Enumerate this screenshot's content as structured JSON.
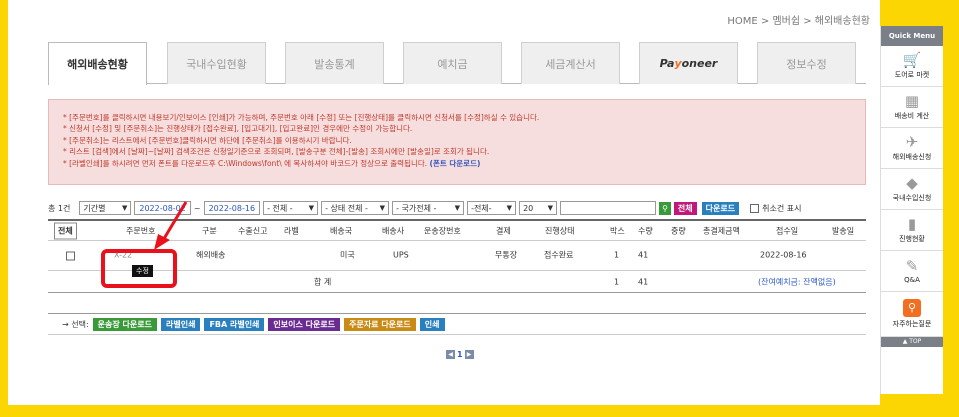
{
  "breadcrumb": "HOME > 멤버쉽 > 해외배송현황",
  "tabs": [
    {
      "label": "해외배송현황",
      "active": true
    },
    {
      "label": "국내수입현황"
    },
    {
      "label": "발송통계"
    },
    {
      "label": "예치금"
    },
    {
      "label": "세금계산서"
    },
    {
      "label": "Payoneer"
    },
    {
      "label": "정보수정"
    }
  ],
  "notice": {
    "lines": [
      "* [주문번호]를 클릭하시면 내용보기/인보이스 [인쇄]가 가능하며, 주문번호 아래 [수정] 또는 [진행상태]를 클릭하시면 신청서를 [수정]하실 수 있습니다.",
      "* 신청서 [수정] 및 [주문취소]는 진행상태가 [접수완료], [입고대기], [입고완료]인 경우에만 수정이 가능합니다.",
      "* [주문취소]는 리스트에서 [주문번호]클릭하시면 하단에 [주문취소]를 이용하시기 바랍니다.",
      "* 리스트 [검색]에서 [날짜]~[날짜] 검색조건은 신청일기준으로 조회되며, [발송구분 전체]-[발송] 조회시에만 [발송일]로 조회가 됩니다.",
      "* [라벨인쇄]를 하시려면 먼저 폰트를 다운로드후 C:\\Windows\\font\\ 에 복사하셔야 바코드가 정상으로 출력됩니다."
    ],
    "font_link": "(폰트 다운로드)"
  },
  "filter": {
    "count": "총 1건",
    "period": "기간별",
    "date_from": "2022-08-02",
    "date_sep": "~",
    "date_to": "2022-08-16",
    "sel_all": "- 전체 -",
    "sel_status": "- 상태 전체 -",
    "sel_country": "- 국가전체 -",
    "sel_all2": "-전체-",
    "page_size": "20",
    "search_btn": "전체",
    "download_btn": "다운로드",
    "cancel_check": "취소건 표시"
  },
  "table": {
    "all_btn": "전체",
    "headers": [
      "주문번호",
      "구분",
      "수출신고",
      "라벨",
      "배송국",
      "배송사",
      "운송장번호",
      "결제",
      "진행상태",
      "박스",
      "수량",
      "중량",
      "총결제금액",
      "접수일",
      "발송일"
    ],
    "row": {
      "order_no": "X-22",
      "edit": "수정",
      "type": "해외배송",
      "country": "미국",
      "carrier": "UPS",
      "payment": "무통장",
      "status": "접수완료",
      "box": "1",
      "qty": "41",
      "date": "2022-08-16"
    },
    "sum": {
      "label": "합 계",
      "box": "1",
      "qty": "41",
      "balance": "(잔여예치금: 잔액없음)"
    }
  },
  "actions": {
    "prefix": "→ 선택:",
    "buttons": [
      {
        "label": "운송장 다운로드",
        "color": "#3a9a3a"
      },
      {
        "label": "라벨인쇄",
        "color": "#2a7fbf"
      },
      {
        "label": "FBA 라벨인쇄",
        "color": "#2a7fbf"
      },
      {
        "label": "인보이스 다운로드",
        "color": "#6a2c91"
      },
      {
        "label": "주문자료 다운로드",
        "color": "#c98a16"
      },
      {
        "label": "인쇄",
        "color": "#2a7fbf"
      }
    ]
  },
  "pager": {
    "prev": "◀",
    "current": "1",
    "next": "▶"
  },
  "sidebar": {
    "header": "Quick Menu",
    "items": [
      {
        "label": "도어로 마켓",
        "icon": "cart-icon"
      },
      {
        "label": "배송비 계산",
        "icon": "calculator-icon"
      },
      {
        "label": "해외배송신청",
        "icon": "airplane-icon"
      },
      {
        "label": "국내수입신청",
        "icon": "box-icon"
      },
      {
        "label": "진행현황",
        "icon": "chart-icon"
      },
      {
        "label": "Q&A",
        "icon": "pencil-icon"
      },
      {
        "label": "자주하는질문",
        "icon": "search-icon"
      }
    ],
    "top": "▲ TOP"
  }
}
